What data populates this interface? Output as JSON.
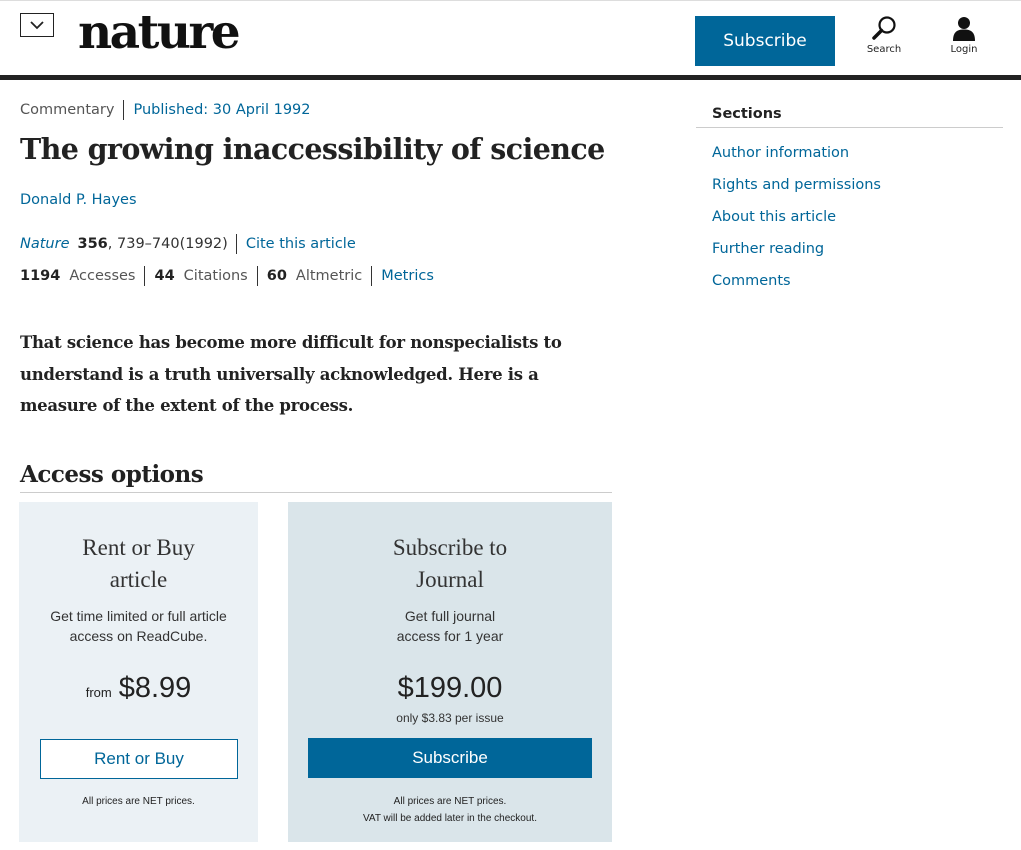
{
  "header": {
    "logo": "nature",
    "subscribe_label": "Subscribe",
    "search_label": "Search",
    "login_label": "Login"
  },
  "article": {
    "type": "Commentary",
    "published": "Published: 30 April 1992",
    "title": "The growing inaccessibility of science",
    "author": "Donald P. Hayes",
    "journal": "Nature",
    "volume": "356",
    "pages": ", 739–740(1992)",
    "cite_label": "Cite this article",
    "metrics": [
      {
        "count": "1194",
        "label": "Accesses"
      },
      {
        "count": "44",
        "label": "Citations"
      },
      {
        "count": "60",
        "label": "Altmetric"
      }
    ],
    "metrics_link": "Metrics",
    "standfirst": "That science has become more difficult for nonspecialists to understand is a truth universally acknowledged. Here is a measure of the extent of the process."
  },
  "access": {
    "heading": "Access options",
    "rent": {
      "title_line1": "Rent or Buy",
      "title_line2": "article",
      "desc_line1": "Get time limited or full article",
      "desc_line2": "access on ReadCube.",
      "from": "from",
      "price": "$8.99",
      "button": "Rent or Buy",
      "note": "All prices are NET prices."
    },
    "subscribe": {
      "title_line1": "Subscribe to",
      "title_line2": "Journal",
      "desc_line1": "Get full journal",
      "desc_line2": "access for 1 year",
      "price": "$199.00",
      "per_issue": "only $3.83 per issue",
      "button": "Subscribe",
      "note_line1": "All prices are NET prices.",
      "note_line2": "VAT will be added later in the checkout."
    }
  },
  "sidebar": {
    "title": "Sections",
    "items": [
      {
        "label": "Author information"
      },
      {
        "label": "Rights and permissions"
      },
      {
        "label": "About this article"
      },
      {
        "label": "Further reading"
      },
      {
        "label": "Comments"
      }
    ]
  },
  "colors": {
    "brand_blue": "#006699",
    "rent_card_bg": "#ebf1f5",
    "subscribe_card_bg": "#dae5ea"
  }
}
